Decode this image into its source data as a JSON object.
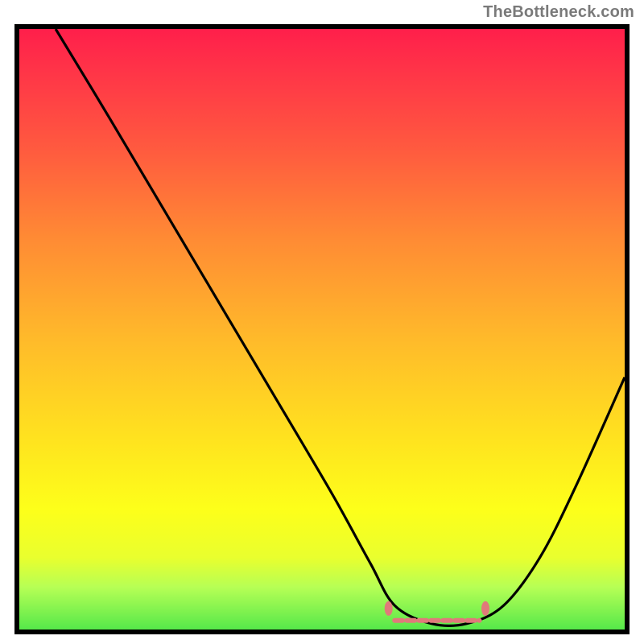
{
  "attribution": "TheBottleneck.com",
  "chart_data": {
    "type": "line",
    "title": "",
    "xlabel": "",
    "ylabel": "",
    "xlim": [
      0,
      100
    ],
    "ylim": [
      0,
      100
    ],
    "series": [
      {
        "name": "bottleneck-curve",
        "color": "#000000",
        "x": [
          6,
          15,
          25,
          35,
          45,
          52,
          58,
          62,
          68,
          74,
          80,
          86,
          92,
          100
        ],
        "y": [
          100,
          85,
          68,
          51,
          34,
          22,
          11,
          4,
          1,
          1,
          4,
          12,
          24,
          42
        ]
      }
    ],
    "markers": [
      {
        "name": "optimal-start",
        "x": 61,
        "y": 3.5,
        "color": "#e07a7a"
      },
      {
        "name": "optimal-end",
        "x": 77,
        "y": 3.5,
        "color": "#e07a7a"
      }
    ],
    "optimal_band": {
      "x_start": 62,
      "x_end": 76,
      "y": 1.5,
      "color": "#e07a7a"
    },
    "gradient_stops": [
      {
        "pos": 0,
        "color": "#ff1f4b"
      },
      {
        "pos": 8,
        "color": "#ff3747"
      },
      {
        "pos": 20,
        "color": "#ff5a3f"
      },
      {
        "pos": 35,
        "color": "#ff8b34"
      },
      {
        "pos": 52,
        "color": "#ffbb2a"
      },
      {
        "pos": 68,
        "color": "#ffe21f"
      },
      {
        "pos": 80,
        "color": "#fdff1a"
      },
      {
        "pos": 88,
        "color": "#e9ff2e"
      },
      {
        "pos": 93,
        "color": "#b6ff55"
      },
      {
        "pos": 100,
        "color": "#56e84a"
      }
    ]
  }
}
